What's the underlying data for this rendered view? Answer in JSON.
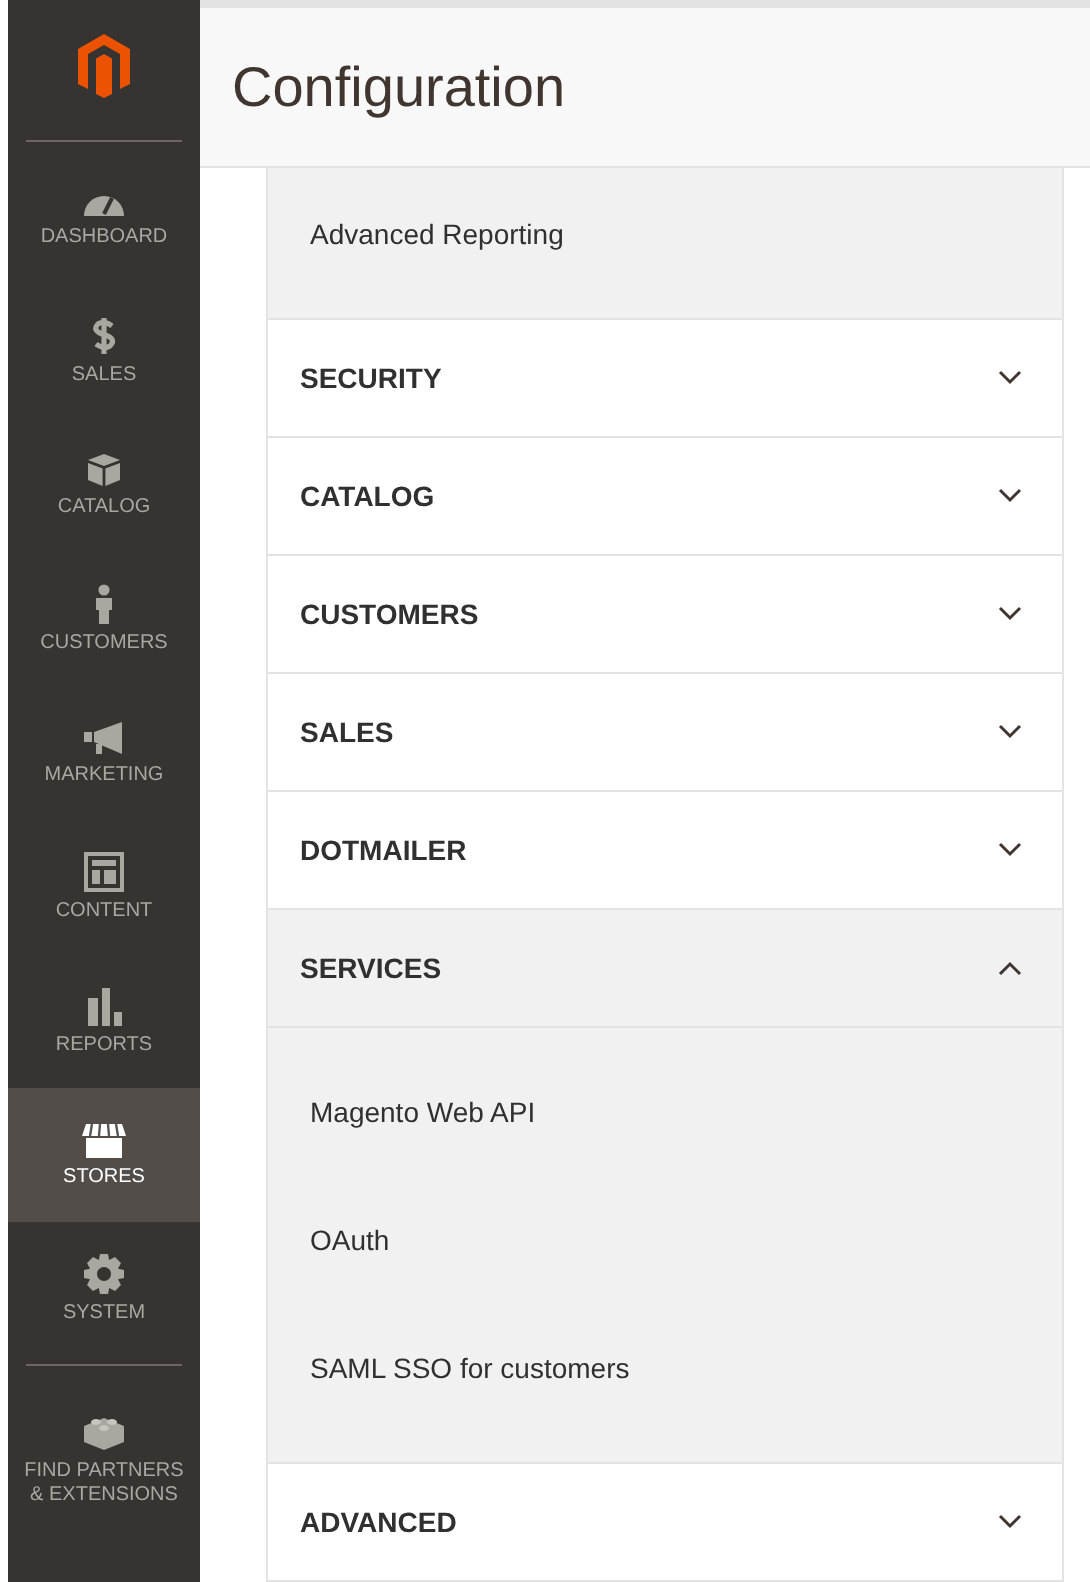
{
  "sidebar": {
    "items": [
      {
        "label": "DASHBOARD",
        "selected": false
      },
      {
        "label": "SALES",
        "selected": false
      },
      {
        "label": "CATALOG",
        "selected": false
      },
      {
        "label": "CUSTOMERS",
        "selected": false
      },
      {
        "label": "MARKETING",
        "selected": false
      },
      {
        "label": "CONTENT",
        "selected": false
      },
      {
        "label": "REPORTS",
        "selected": false
      },
      {
        "label": "STORES",
        "selected": true
      },
      {
        "label": "SYSTEM",
        "selected": false
      },
      {
        "label": "FIND PARTNERS & EXTENSIONS",
        "selected": false
      }
    ]
  },
  "page_title": "Configuration",
  "config_tabs": [
    {
      "title": "Advanced Reporting",
      "kind": "link"
    },
    {
      "title": "SECURITY",
      "kind": "section",
      "expanded": false
    },
    {
      "title": "CATALOG",
      "kind": "section",
      "expanded": false
    },
    {
      "title": "CUSTOMERS",
      "kind": "section",
      "expanded": false
    },
    {
      "title": "SALES",
      "kind": "section",
      "expanded": false
    },
    {
      "title": "DOTMAILER",
      "kind": "section",
      "expanded": false
    },
    {
      "title": "SERVICES",
      "kind": "section",
      "expanded": true,
      "children": [
        {
          "title": "Magento Web API"
        },
        {
          "title": "OAuth"
        },
        {
          "title": "SAML SSO for customers"
        }
      ]
    },
    {
      "title": "ADVANCED",
      "kind": "section",
      "expanded": false
    }
  ]
}
